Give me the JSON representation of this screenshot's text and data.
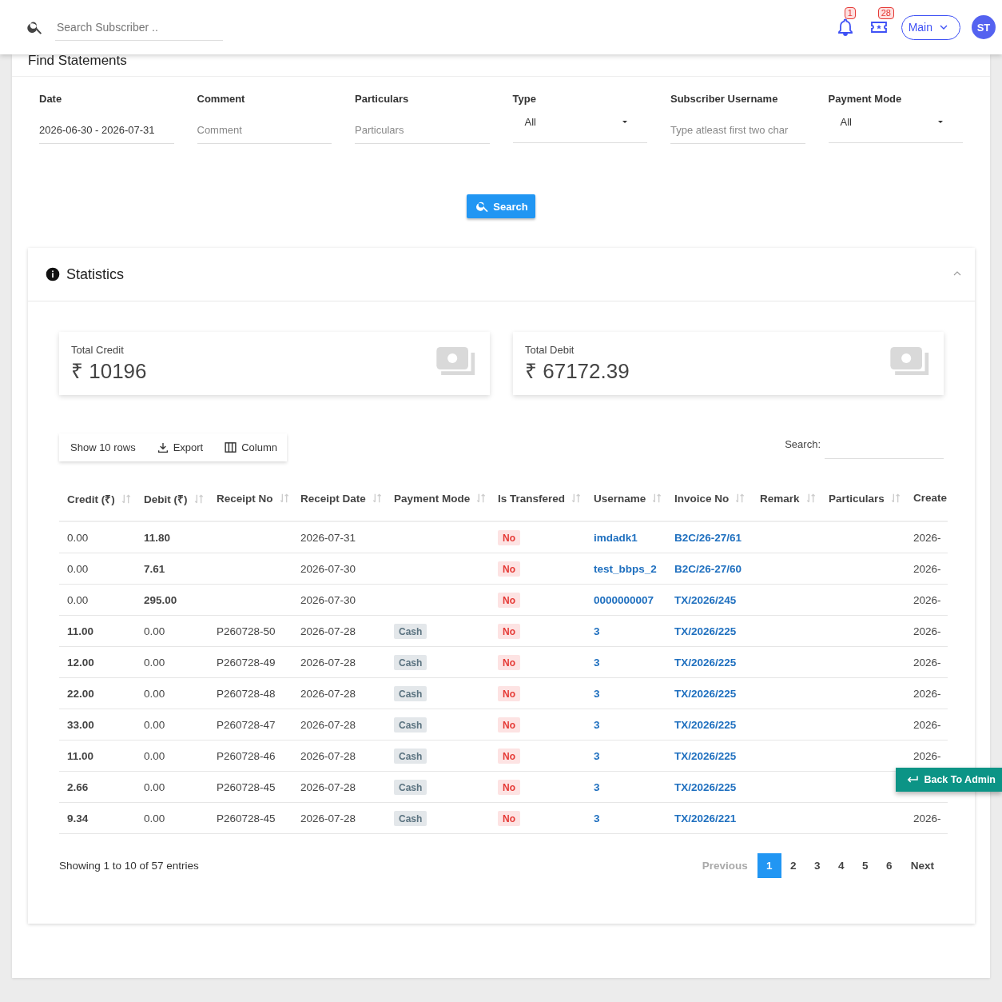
{
  "header": {
    "search": {
      "placeholder": "Search Subscriber .."
    },
    "notifications": {
      "count": "1"
    },
    "tickets": {
      "count": "28"
    },
    "menu": {
      "label": "Main"
    },
    "avatar": {
      "initials": "ST"
    }
  },
  "panel": {
    "title": "Find Statements"
  },
  "filters": [
    {
      "label": "Date",
      "kind": "text",
      "value": "2026-06-30 - 2026-07-31"
    },
    {
      "label": "Comment",
      "kind": "text",
      "placeholder": "Comment"
    },
    {
      "label": "Particulars",
      "kind": "text",
      "placeholder": "Particulars"
    },
    {
      "label": "Type",
      "kind": "select",
      "value": "All"
    },
    {
      "label": "Subscriber Username",
      "kind": "text",
      "placeholder": "Type atleast first two char"
    },
    {
      "label": "Payment Mode",
      "kind": "select",
      "value": "All"
    }
  ],
  "search_button": {
    "label": "Search"
  },
  "statistics": {
    "title": "Statistics",
    "expanded": true,
    "cards": [
      {
        "label": "Total Credit",
        "value": "₹ 10196"
      },
      {
        "label": "Total Debit",
        "value": "₹ 67172.39"
      }
    ]
  },
  "toolbar": {
    "buttons": [
      {
        "kind": "rows",
        "label": "Show 10 rows"
      },
      {
        "kind": "export",
        "label": "Export"
      },
      {
        "kind": "columns",
        "label": "Column"
      }
    ],
    "search_label": "Search:"
  },
  "table": {
    "columns": [
      {
        "kind": "credit",
        "label": "Credit (₹)",
        "sortable": true
      },
      {
        "kind": "debit",
        "label": "Debit (₹)",
        "sortable": true
      },
      {
        "kind": "text",
        "label": "Receipt No",
        "sortable": true
      },
      {
        "kind": "text",
        "label": "Receipt Date",
        "sortable": true
      },
      {
        "kind": "tag",
        "label": "Payment Mode",
        "sortable": true
      },
      {
        "kind": "flag",
        "label": "Is Transfered",
        "sortable": true
      },
      {
        "kind": "link",
        "label": "Username",
        "sortable": true
      },
      {
        "kind": "link",
        "label": "Invoice No",
        "sortable": true
      },
      {
        "label": "Remark",
        "sortable": true
      },
      {
        "label": "Particulars",
        "sortable": true
      },
      {
        "kind": "text",
        "label": "Create",
        "sortable": false
      }
    ],
    "rows": [
      {
        "kind": "debit",
        "cells": [
          "0.00",
          "11.80",
          null,
          "2026-07-31",
          null,
          "No",
          "imdadk1",
          "B2C/26-27/61",
          null,
          null,
          "2026-"
        ]
      },
      {
        "kind": "debit",
        "cells": [
          "0.00",
          "7.61",
          null,
          "2026-07-30",
          null,
          "No",
          "test_bbps_2",
          "B2C/26-27/60",
          null,
          null,
          "2026-"
        ]
      },
      {
        "kind": "debit",
        "cells": [
          "0.00",
          "295.00",
          null,
          "2026-07-30",
          null,
          "No",
          "0000000007",
          "TX/2026/245",
          null,
          null,
          "2026-"
        ]
      },
      {
        "kind": "credit",
        "cells": [
          "11.00",
          "0.00",
          "P260728-50",
          "2026-07-28",
          "Cash",
          "No",
          "3",
          "TX/2026/225",
          null,
          null,
          "2026-"
        ]
      },
      {
        "kind": "credit",
        "cells": [
          "12.00",
          "0.00",
          "P260728-49",
          "2026-07-28",
          "Cash",
          "No",
          "3",
          "TX/2026/225",
          null,
          null,
          "2026-"
        ]
      },
      {
        "kind": "credit",
        "cells": [
          "22.00",
          "0.00",
          "P260728-48",
          "2026-07-28",
          "Cash",
          "No",
          "3",
          "TX/2026/225",
          null,
          null,
          "2026-"
        ]
      },
      {
        "kind": "credit",
        "cells": [
          "33.00",
          "0.00",
          "P260728-47",
          "2026-07-28",
          "Cash",
          "No",
          "3",
          "TX/2026/225",
          null,
          null,
          "2026-"
        ]
      },
      {
        "kind": "credit",
        "cells": [
          "11.00",
          "0.00",
          "P260728-46",
          "2026-07-28",
          "Cash",
          "No",
          "3",
          "TX/2026/225",
          null,
          null,
          "2026-"
        ]
      },
      {
        "kind": "credit",
        "cells": [
          "2.66",
          "0.00",
          "P260728-45",
          "2026-07-28",
          "Cash",
          "No",
          "3",
          "TX/2026/225",
          null,
          null,
          null
        ]
      },
      {
        "kind": "credit",
        "cells": [
          "9.34",
          "0.00",
          "P260728-45",
          "2026-07-28",
          "Cash",
          "No",
          "3",
          "TX/2026/221",
          null,
          null,
          "2026-"
        ]
      }
    ]
  },
  "footer": {
    "info": "Showing 1 to 10 of 57 entries",
    "pages": [
      {
        "kind": "prev",
        "label": "Previous",
        "selected": false,
        "disabled": true
      },
      {
        "kind": "page",
        "label": "1",
        "selected": true,
        "disabled": false
      },
      {
        "kind": "page",
        "label": "2",
        "selected": false,
        "disabled": false
      },
      {
        "kind": "page",
        "label": "3",
        "selected": false,
        "disabled": false
      },
      {
        "kind": "page",
        "label": "4",
        "selected": false,
        "disabled": false
      },
      {
        "kind": "page",
        "label": "5",
        "selected": false,
        "disabled": false
      },
      {
        "kind": "page",
        "label": "6",
        "selected": false,
        "disabled": false
      },
      {
        "kind": "next",
        "label": "Next",
        "selected": false,
        "disabled": false
      }
    ]
  },
  "back_button": {
    "label": "Back To Admin"
  }
}
